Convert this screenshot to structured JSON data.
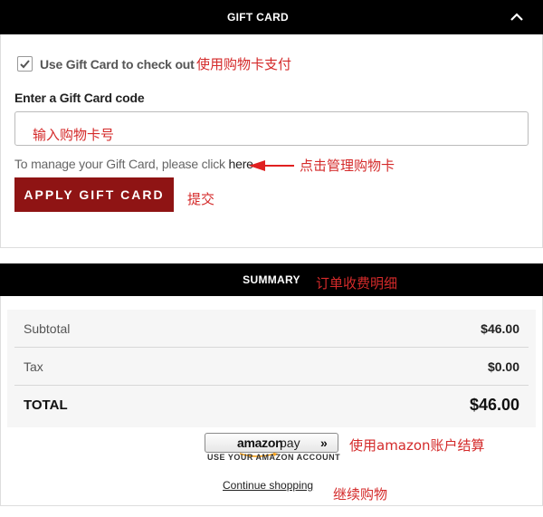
{
  "gift_card": {
    "title": "GIFT CARD",
    "use_label": "Use Gift Card to check out",
    "use_checked": true,
    "code_label": "Enter a Gift Card code",
    "code_value": "",
    "manage_text": "To manage your Gift Card, please click ",
    "manage_link": "here",
    "apply_label": "APPLY GIFT CARD"
  },
  "summary": {
    "title": "SUMMARY",
    "rows": [
      {
        "label": "Subtotal",
        "value": "$46.00"
      },
      {
        "label": "Tax",
        "value": "$0.00"
      }
    ],
    "total_label": "TOTAL",
    "total_value": "$46.00"
  },
  "amazon_pay": {
    "word": "amazon",
    "pay": "pay",
    "chevrons": "»",
    "subtitle": "USE YOUR AMAZON ACCOUNT"
  },
  "continue_label": "Continue shopping",
  "annotations": {
    "use_gift_card": "使用购物卡支付",
    "enter_code": "输入购物卡号",
    "manage": "点击管理购物卡",
    "submit": "提交",
    "summary": "订单收费明细",
    "amazon": "使用amazon账户结算",
    "continue": "继续购物"
  },
  "colors": {
    "header_bg": "#000000",
    "apply_button": "#8f1414",
    "annotation": "#d42a2a"
  },
  "icons": {
    "collapse": "chevron-up-icon",
    "checkbox": "checkmark-icon",
    "annotation_arrow": "arrow-left-icon"
  }
}
